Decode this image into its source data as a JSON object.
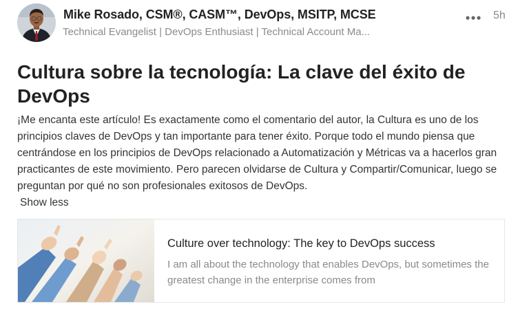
{
  "post": {
    "author": {
      "name": "Mike Rosado, CSM®, CASM™, DevOps, MSITP, MCSE",
      "headline": "Technical Evangelist | DevOps Enthusiast | Technical Account Ma..."
    },
    "more_icon": "more-horizontal-icon",
    "timestamp": "5h",
    "title": "Cultura sobre la tecnología: La clave del éxito de DevOps",
    "body": "¡Me encanta este artículo! Es exactamente como el comentario del autor, la Cultura es uno de los principios claves de DevOps y tan importante para tener éxito. Porque todo el mundo piensa que centrándose en los principios de DevOps relacionado a Automatización y Métricas va a hacerlos gran practicantes de este movimiento. Pero parecen olvidarse de Cultura y Compartir/Comunicar, luego se preguntan por qué no son profesionales exitosos de DevOps.",
    "show_less_label": "Show less",
    "link_card": {
      "title": "Culture over technology: The key to DevOps success",
      "description": "I am all about the technology that enables DevOps, but sometimes the greatest change in the enterprise comes from"
    }
  }
}
